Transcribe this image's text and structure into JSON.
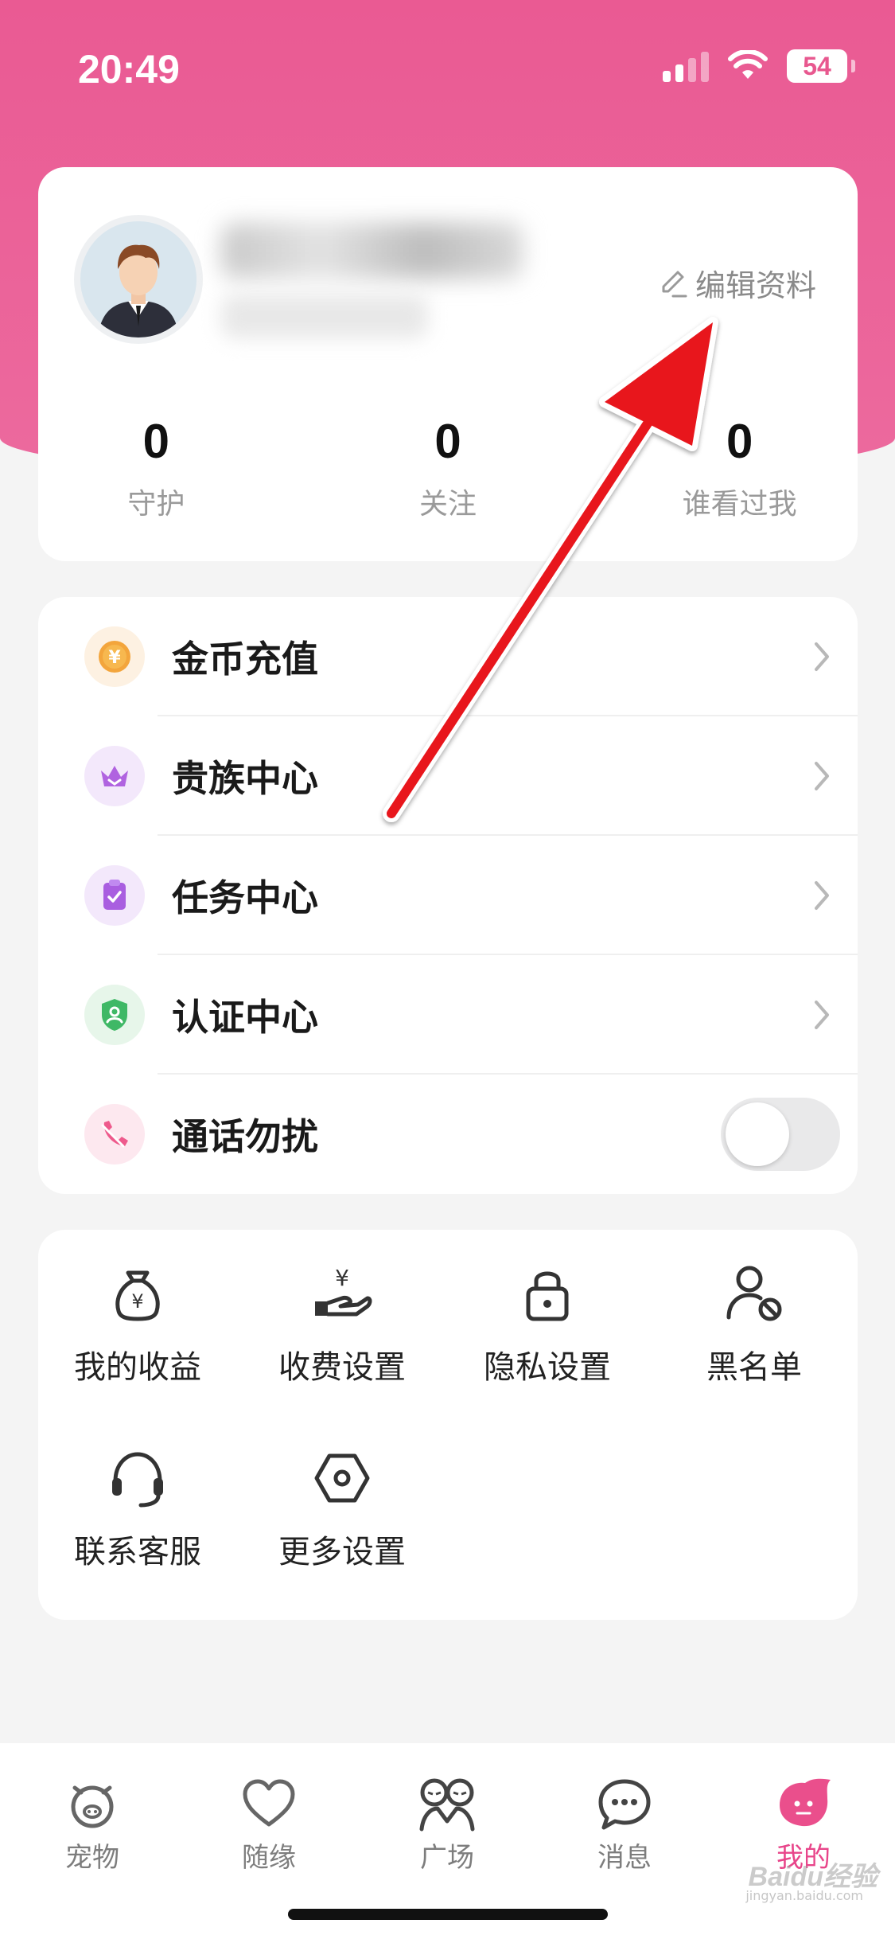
{
  "status_bar": {
    "time": "20:49",
    "battery": "54"
  },
  "profile": {
    "edit_label": "编辑资料",
    "stats": [
      {
        "value": "0",
        "label": "守护"
      },
      {
        "value": "0",
        "label": "关注"
      },
      {
        "value": "0",
        "label": "谁看过我"
      }
    ]
  },
  "menu": {
    "items": [
      {
        "label": "金币充值",
        "icon": "coin-icon"
      },
      {
        "label": "贵族中心",
        "icon": "crown-icon"
      },
      {
        "label": "任务中心",
        "icon": "clipboard-icon"
      },
      {
        "label": "认证中心",
        "icon": "shield-icon"
      },
      {
        "label": "通话勿扰",
        "icon": "phone-off-icon",
        "toggle_on": false
      }
    ]
  },
  "grid": {
    "items": [
      {
        "label": "我的收益",
        "icon": "money-bag-icon"
      },
      {
        "label": "收费设置",
        "icon": "hand-coin-icon"
      },
      {
        "label": "隐私设置",
        "icon": "lock-icon"
      },
      {
        "label": "黑名单",
        "icon": "user-block-icon"
      },
      {
        "label": "联系客服",
        "icon": "headset-icon"
      },
      {
        "label": "更多设置",
        "icon": "hexagon-icon"
      }
    ]
  },
  "tabbar": {
    "tabs": [
      {
        "label": "宠物",
        "icon": "pig-icon"
      },
      {
        "label": "随缘",
        "icon": "heart-icon"
      },
      {
        "label": "广场",
        "icon": "people-icon"
      },
      {
        "label": "消息",
        "icon": "chat-icon"
      },
      {
        "label": "我的",
        "icon": "profile-blob-icon",
        "active": true
      }
    ]
  },
  "watermark": {
    "text": "Baidu经验",
    "sub": "jingyan.baidu.com"
  },
  "colors": {
    "brand_pink": "#ea5a93",
    "annotation_arrow": "#e8141c"
  }
}
